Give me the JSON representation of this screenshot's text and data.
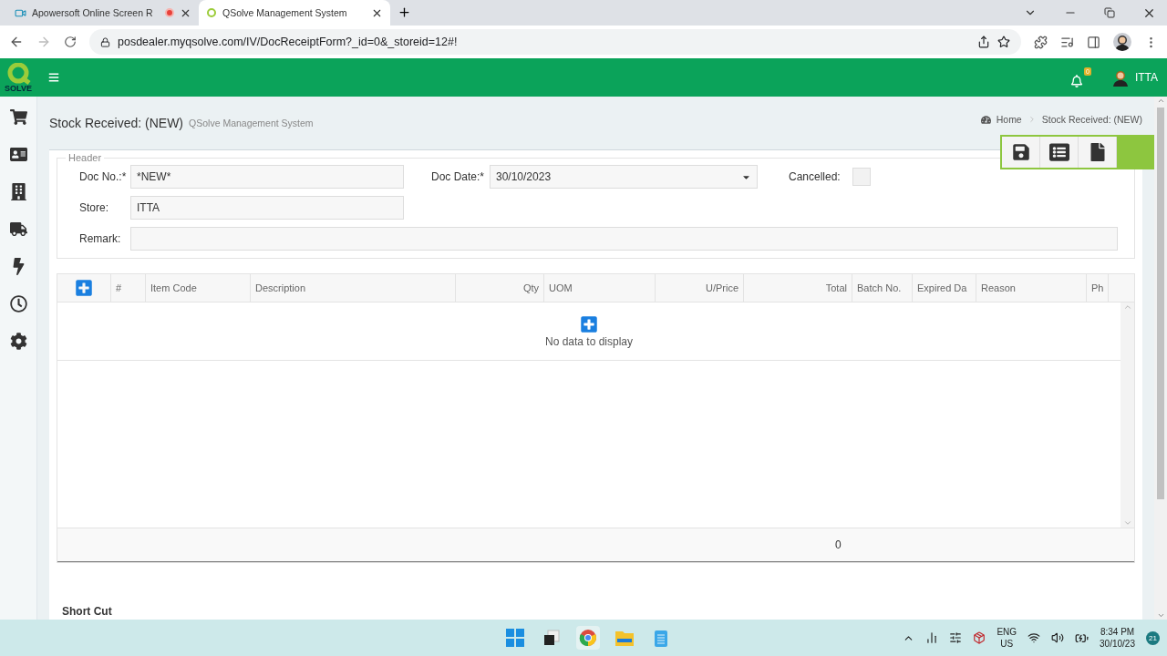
{
  "browser": {
    "tabs": [
      {
        "title": "Apowersoft Online Screen R",
        "selected": false,
        "recording": true
      },
      {
        "title": "QSolve Management System",
        "selected": true,
        "recording": false
      }
    ],
    "url": "posdealer.myqsolve.com/IV/DocReceiptForm?_id=0&_storeid=12#!"
  },
  "app_header": {
    "logo_text": "SOLVE",
    "notification_count": "0",
    "user": "ITTA"
  },
  "page": {
    "title": "Stock Received: (NEW)",
    "subtitle": "QSolve Management System",
    "breadcrumb": [
      "Home",
      "Stock Received: (NEW)"
    ]
  },
  "form": {
    "legend": "Header",
    "doc_no": {
      "label": "Doc No.:*",
      "value": "*NEW*"
    },
    "doc_date": {
      "label": "Doc Date:*",
      "value": "30/10/2023"
    },
    "cancelled": {
      "label": "Cancelled:",
      "checked": false
    },
    "store": {
      "label": "Store:",
      "value": "ITTA"
    },
    "remark": {
      "label": "Remark:"
    }
  },
  "grid": {
    "columns": [
      {
        "label": "#"
      },
      {
        "label": "Item Code"
      },
      {
        "label": "Description"
      },
      {
        "label": "Qty"
      },
      {
        "label": "UOM"
      },
      {
        "label": "U/Price"
      },
      {
        "label": "Total"
      },
      {
        "label": "Batch No."
      },
      {
        "label": "Expired Da"
      },
      {
        "label": "Reason"
      },
      {
        "label": "Ph"
      }
    ],
    "empty_text": "No data to display",
    "footer_total": "0"
  },
  "shortcut_title": "Short Cut",
  "taskbar": {
    "language": "ENG",
    "region": "US",
    "time": "8:34 PM",
    "date": "30/10/23",
    "notification_count": "21"
  }
}
